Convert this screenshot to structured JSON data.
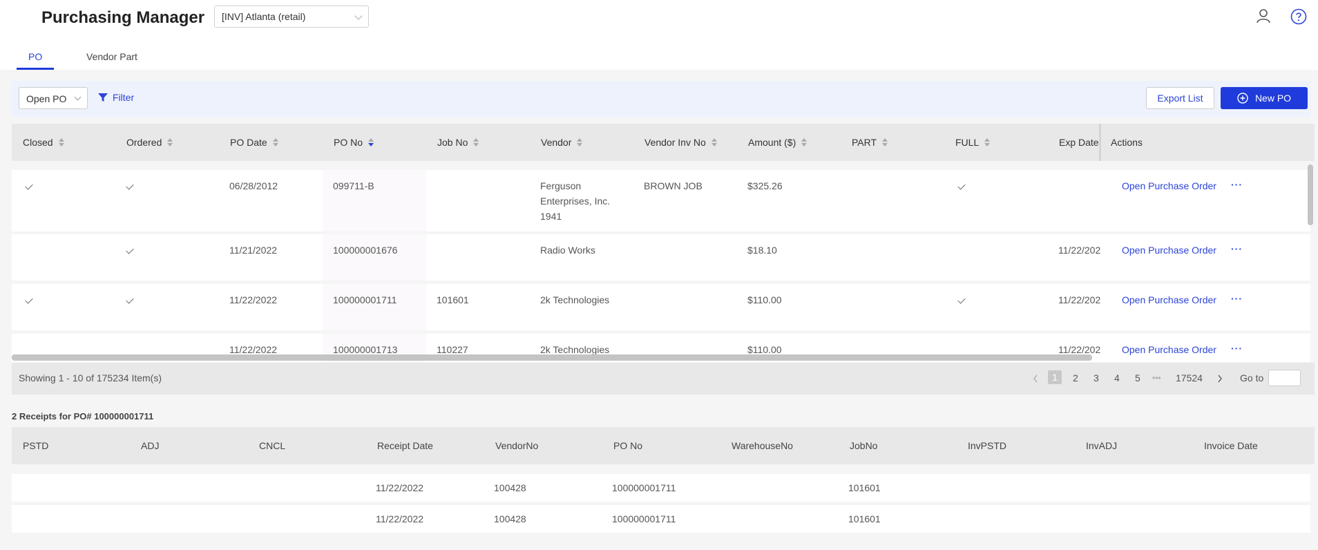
{
  "app": {
    "title": "Purchasing Manager",
    "store": "[INV] Atlanta (retail)"
  },
  "tabs": [
    {
      "label": "PO",
      "active": true
    },
    {
      "label": "Vendor Part",
      "active": false
    }
  ],
  "toolbar": {
    "view": "Open PO",
    "filter_label": "Filter",
    "export_label": "Export List",
    "new_po_label": "New PO"
  },
  "grid": {
    "columns": [
      "Closed",
      "Ordered",
      "PO Date",
      "PO No",
      "Job No",
      "Vendor",
      "Vendor Inv No",
      "Amount ($)",
      "PART",
      "FULL",
      "Exp Date",
      "Actions"
    ],
    "sorted_column": "PO No",
    "rows": [
      {
        "closed": true,
        "ordered": true,
        "po_date": "06/28/2012",
        "po_no": "099711-B",
        "job_no": "",
        "vendor": [
          "Ferguson",
          "Enterprises, Inc.",
          "1941"
        ],
        "vendor_inv_no": "BROWN JOB",
        "amount": "$325.26",
        "part": false,
        "full": true,
        "exp_date": "",
        "action": "Open Purchase Order",
        "more": "···"
      },
      {
        "closed": false,
        "ordered": true,
        "po_date": "11/21/2022",
        "po_no": "100000001676",
        "job_no": "",
        "vendor": [
          "Radio Works"
        ],
        "vendor_inv_no": "",
        "amount": "$18.10",
        "part": false,
        "full": false,
        "exp_date": "11/22/202",
        "action": "Open Purchase Order",
        "more": "···"
      },
      {
        "closed": true,
        "ordered": true,
        "po_date": "11/22/2022",
        "po_no": "100000001711",
        "job_no": "101601",
        "vendor": [
          "2k Technologies"
        ],
        "vendor_inv_no": "",
        "amount": "$110.00",
        "part": false,
        "full": true,
        "exp_date": "11/22/202",
        "action": "Open Purchase Order",
        "more": "···"
      },
      {
        "closed": false,
        "ordered": false,
        "po_date": "11/22/2022",
        "po_no": "100000001713",
        "job_no": "110227",
        "vendor": [
          "2k Technologies"
        ],
        "vendor_inv_no": "",
        "amount": "$110.00",
        "part": false,
        "full": false,
        "exp_date": "11/22/202",
        "action": "Open Purchase Order",
        "more": "···"
      }
    ]
  },
  "pager": {
    "showing": "Showing 1 - 10 of 175234 Item(s)",
    "pages": [
      "1",
      "2",
      "3",
      "4",
      "5"
    ],
    "active_page": "1",
    "ellipsis": "•••",
    "last_page": "17524",
    "goto_label": "Go to",
    "prev_icon": "chevron-left-icon",
    "next_icon": "chevron-right-icon"
  },
  "receipts": {
    "title": "2 Receipts for PO# 100000001711",
    "columns": [
      "PSTD",
      "ADJ",
      "CNCL",
      "Receipt Date",
      "VendorNo",
      "PO No",
      "WarehouseNo",
      "JobNo",
      "InvPSTD",
      "InvADJ",
      "Invoice Date"
    ],
    "rows": [
      {
        "receipt_date": "11/22/2022",
        "vendor_no": "100428",
        "po_no": "100000001711",
        "job_no": "101601"
      },
      {
        "receipt_date": "11/22/2022",
        "vendor_no": "100428",
        "po_no": "100000001711",
        "job_no": "101601"
      }
    ]
  },
  "colors": {
    "accent": "#1f3bdb",
    "link": "#2c44d6",
    "header_bg": "#e8e8e8",
    "toolbar_bg": "#eef2fd"
  }
}
